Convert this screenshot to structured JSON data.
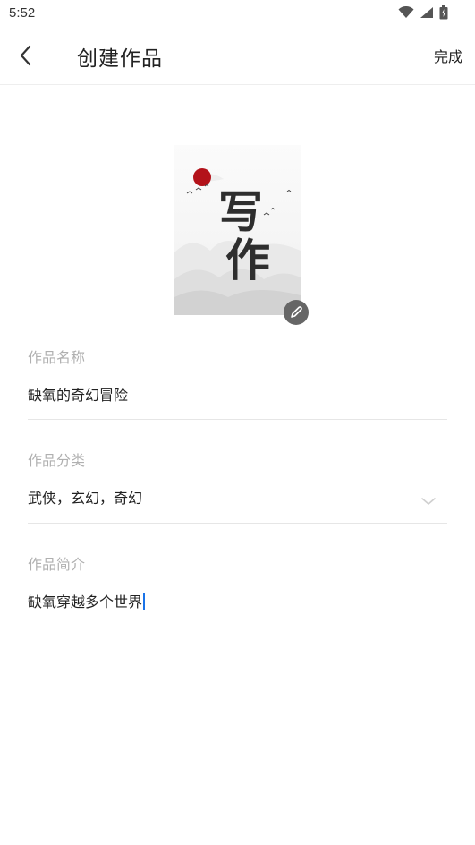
{
  "status_bar": {
    "time": "5:52",
    "icons": [
      "wifi-icon",
      "cellular-signal-icon",
      "battery-icon"
    ]
  },
  "app_bar": {
    "title": "创建作品",
    "done_label": "完成",
    "back_icon": "chevron-left-icon"
  },
  "cover": {
    "calligraphy_text": "写作",
    "edit_icon": "pencil-icon"
  },
  "form": {
    "name": {
      "label": "作品名称",
      "value": "缺氧的奇幻冒险"
    },
    "category": {
      "label": "作品分类",
      "value": "武侠，玄幻，奇幻"
    },
    "intro": {
      "label": "作品简介",
      "value": "缺氧穿越多个世界"
    }
  },
  "colors": {
    "text": "#222222",
    "label": "#b0b0b0",
    "divider": "#e6e6e6",
    "caret": "#1a73e8",
    "edit_button_bg": "#666666",
    "cover_sun": "#b3121a"
  }
}
